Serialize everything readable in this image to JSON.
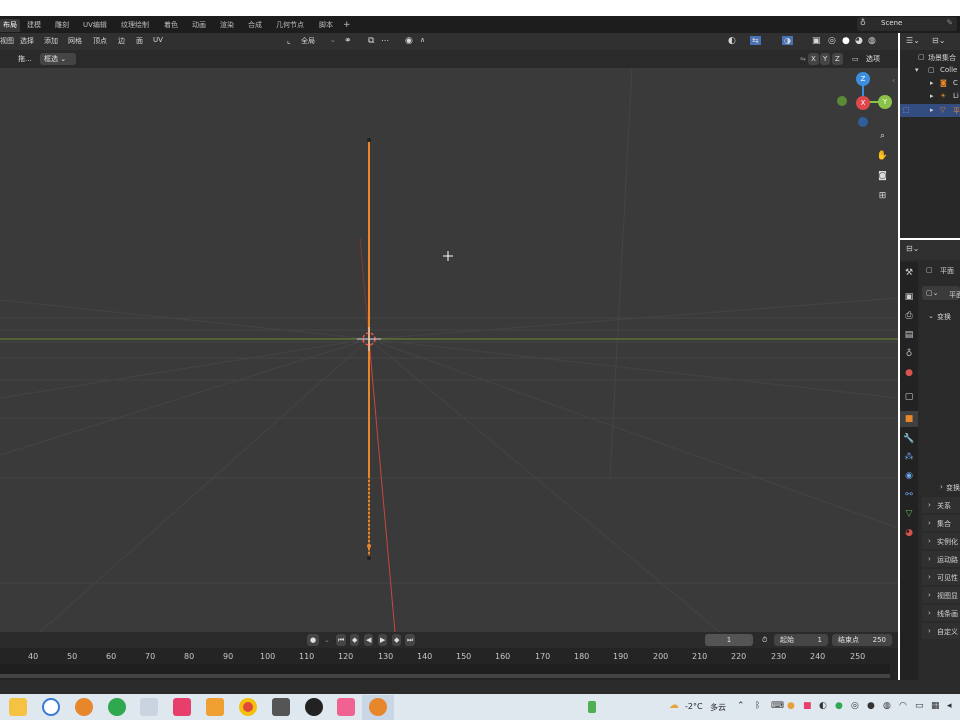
{
  "workspace_tabs": [
    "布局",
    "建模",
    "雕刻",
    "UV编辑",
    "纹理绘制",
    "着色",
    "动画",
    "渲染",
    "合成",
    "几何节点",
    "脚本",
    "+"
  ],
  "scene_name": "Scene",
  "header_menus": [
    "视图",
    "选择",
    "添加",
    "网格",
    "顶点",
    "边",
    "面",
    "UV"
  ],
  "transform_orientation": "全局",
  "header2": {
    "drag_label": "拖...",
    "select_mode": "框选",
    "options": "选项",
    "axes": [
      "X",
      "Y",
      "Z"
    ]
  },
  "outliner": {
    "root": "场景集合",
    "collection": "Colle",
    "items": [
      "C",
      "Li",
      "平"
    ]
  },
  "properties": {
    "object_name": "平面",
    "mesh_name": "平面",
    "transform": "变换",
    "delta": "变换",
    "sections": [
      "关系",
      "集合",
      "实例化",
      "运动路",
      "可见性",
      "视图显",
      "线条画",
      "自定义"
    ]
  },
  "timeline": {
    "current_frame": "1",
    "start_label": "起始",
    "start": "1",
    "end_label": "结束点",
    "end": "250",
    "ticks": [
      "40",
      "50",
      "60",
      "70",
      "80",
      "90",
      "100",
      "110",
      "120",
      "130",
      "140",
      "150",
      "160",
      "170",
      "180",
      "190",
      "200",
      "210",
      "220",
      "230",
      "240",
      "250"
    ]
  },
  "gizmo": {
    "x": "X",
    "y": "Y",
    "z": "Z"
  },
  "taskbar": {
    "weather_temp": "-2°C",
    "weather_text": "多云"
  },
  "colors": {
    "accent_orange": "#e8862c",
    "selection_blue": "#4772b3",
    "x_axis": "#e0474b",
    "y_axis": "#8bc34a",
    "z_axis": "#3d8ee0"
  }
}
